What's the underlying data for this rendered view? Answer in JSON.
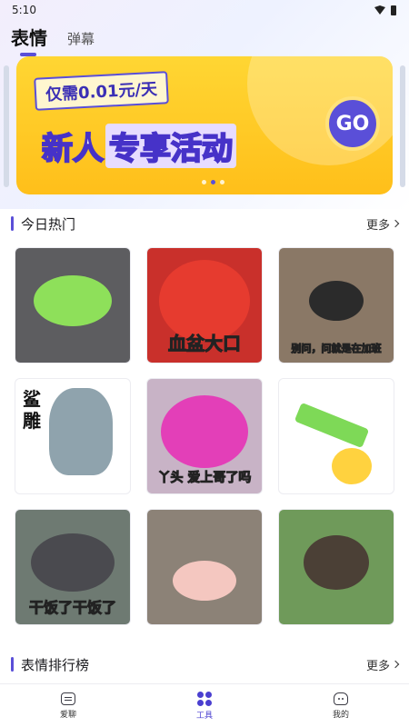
{
  "status_bar": {
    "time": "5:10"
  },
  "header": {
    "tabs": [
      {
        "label": "表情",
        "active": true
      },
      {
        "label": "弹幕",
        "active": false
      }
    ]
  },
  "banner": {
    "price_text": "仅需0.01元/天",
    "title_plain": "新人",
    "title_boxed": "专享活动",
    "go_label": "GO",
    "slide_count": 3,
    "active_slide": 2
  },
  "sections": {
    "hot_today": {
      "title": "今日热门",
      "more": "更多"
    },
    "ranking": {
      "title": "表情排行榜",
      "more": "更多"
    }
  },
  "stickers": [
    {
      "caption": "",
      "bg": "#5d5d60",
      "art": "#8ee05a"
    },
    {
      "caption": "血盆大口",
      "bg": "#c9302b",
      "art": "#e63b2f"
    },
    {
      "caption": "别问，问就是在加班",
      "bg": "#8a7866",
      "art": "#2b2b2b"
    },
    {
      "caption": "",
      "side_text": "鲨雕",
      "bg": "#ffffff",
      "art": "#8fa3ad"
    },
    {
      "caption": "丫头 爱上哥了吗",
      "bg": "#c8b3c6",
      "art": "#e33fb8"
    },
    {
      "caption": "",
      "bg": "#ffffff",
      "art": "#7ed957"
    },
    {
      "caption": "干饭了干饭了",
      "bg": "#6e7a72",
      "art": "#4a4a4f"
    },
    {
      "caption": "",
      "bg": "#8c8277",
      "art": "#f4c7c0"
    },
    {
      "caption": "",
      "bg": "#6f9a5a",
      "art": "#4b4036"
    }
  ],
  "bottom_nav": [
    {
      "label": "爱聊",
      "icon": "chat-icon",
      "active": false
    },
    {
      "label": "工具",
      "icon": "tools-icon",
      "active": true
    },
    {
      "label": "我的",
      "icon": "profile-icon",
      "active": false
    }
  ]
}
